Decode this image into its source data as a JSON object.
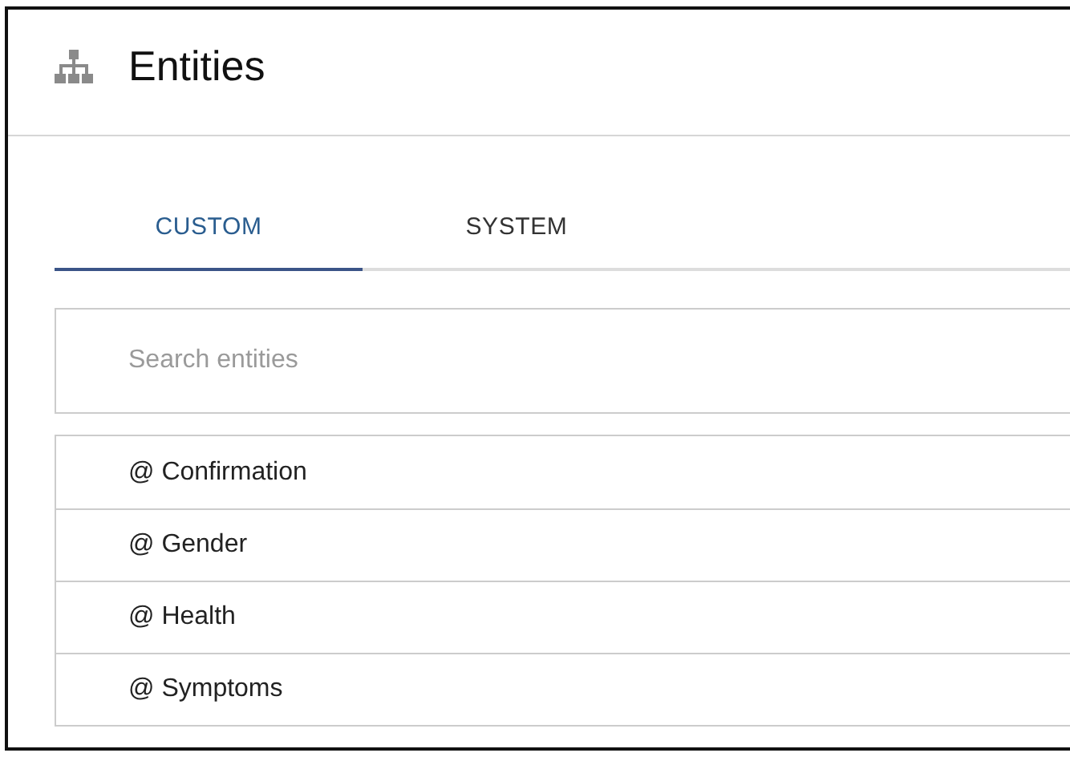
{
  "header": {
    "title": "Entities"
  },
  "tabs": [
    {
      "label": "CUSTOM",
      "selected": true
    },
    {
      "label": "SYSTEM",
      "selected": false
    }
  ],
  "search": {
    "placeholder": "Search entities"
  },
  "entities": [
    "@ Confirmation",
    "@ Gender",
    "@ Health",
    "@ Symptoms"
  ]
}
